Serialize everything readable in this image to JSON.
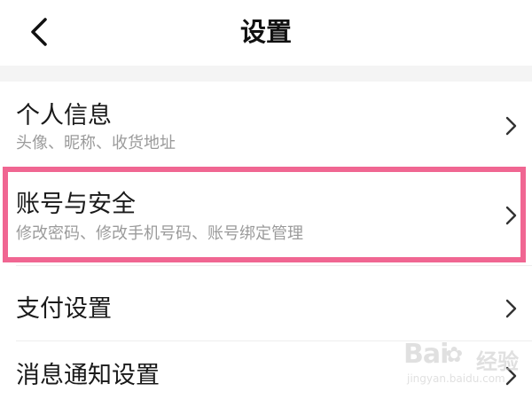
{
  "header": {
    "title": "设置",
    "back_icon": "chevron-left-icon"
  },
  "settings": {
    "items": [
      {
        "title": "个人信息",
        "subtitle": "头像、昵称、收货地址",
        "icon": "chevron-right-icon"
      },
      {
        "title": "账号与安全",
        "subtitle": "修改密码、修改手机号码、账号绑定管理",
        "icon": "chevron-right-icon",
        "highlighted": true
      },
      {
        "title": "支付设置",
        "icon": "chevron-right-icon"
      },
      {
        "title": "消息通知设置",
        "icon": "chevron-right-icon"
      }
    ]
  },
  "colors": {
    "highlight_border": "#f06692",
    "subtitle_text": "#9b9b9b",
    "section_gap": "#f4f4f4"
  },
  "watermark": {
    "logo": "Bai",
    "logo_tail": "经验",
    "url": "jingyan.baidu.com"
  }
}
